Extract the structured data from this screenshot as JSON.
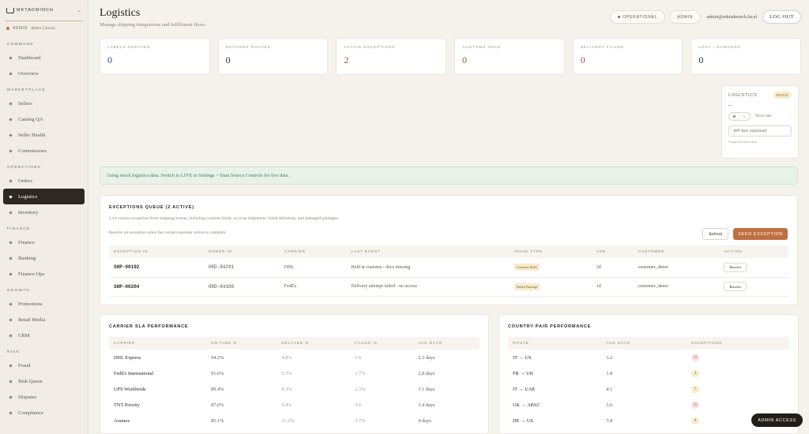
{
  "brand": {
    "name": "MKTADMINCH",
    "role_label": "ADMIN",
    "role_sub": "Admin Console"
  },
  "nav": {
    "sections": [
      {
        "title": "COMMAND",
        "items": [
          "Dashboard",
          "Overview"
        ]
      },
      {
        "title": "MARKETPLACE",
        "items": [
          "Sellers",
          "Catalog QA",
          "Seller Health",
          "Commissions"
        ]
      },
      {
        "title": "OPERATIONS",
        "items": [
          "Orders",
          "Logistics",
          "Inventory"
        ]
      },
      {
        "title": "FINANCE",
        "items": [
          "Finance",
          "Banking",
          "Finance Ops"
        ]
      },
      {
        "title": "GROWTH",
        "items": [
          "Promotions",
          "Retail Media",
          "CRM"
        ]
      },
      {
        "title": "RISK",
        "items": [
          "Fraud",
          "Risk Queue",
          "Disputes",
          "Compliance"
        ]
      }
    ],
    "active": "Logistics"
  },
  "header": {
    "title": "Logistics",
    "subtitle": "Manage shipping integrations and fulfillment flows",
    "status_pill": "OPERATIONAL",
    "admin_pill": "ADMIN",
    "email": "admin@mktadminch.local",
    "logout": "LOG OUT"
  },
  "kpis": [
    {
      "label": "LABELS CREATED",
      "value": "0",
      "color": "#3a4a8a"
    },
    {
      "label": "RETURNS ROUTED",
      "value": "0",
      "color": "#2a2520"
    },
    {
      "label": "ACTIVE EXCEPTIONS",
      "value": "2",
      "color": "#b54a4a"
    },
    {
      "label": "CUSTOMS HOLD",
      "value": "0",
      "color": "#8c6d1c"
    },
    {
      "label": "DELIVERY FAILED",
      "value": "0",
      "color": "#b54a4a"
    },
    {
      "label": "LOST / DAMAGED",
      "value": "0",
      "color": "#2a2520"
    }
  ],
  "data_source": {
    "title": "LOGISTICS",
    "badge": "MOCK",
    "toggle_m": "M",
    "toggle_l": "L",
    "toggle_label": "Mock data",
    "api_key_placeholder": "API Key (optional)",
    "hint": "Using local mock data"
  },
  "notice": "Using mock logistics data. Switch to LIVE in Settings > Data Source Controls for live data.",
  "exceptions": {
    "title": "EXCEPTIONS QUEUE (2 ACTIVE)",
    "desc": "Live carrier exceptions from shipping events, including customs holds, no-scan shipments, failed deliveries, and damaged packages.",
    "desc2": "Resolve an exception when the carrier/customer action is complete.",
    "refresh": "Refresh",
    "seed": "SEED EXCEPTION",
    "columns": [
      "EXCEPTION ID",
      "ORDER ID",
      "CARRIER",
      "LAST EVENT",
      "ISSUE TYPE",
      "AGE",
      "CUSTOMER",
      "ACTION"
    ],
    "rows": [
      {
        "id": "SHP-00192",
        "order": "ORD-84291",
        "carrier": "DHL",
        "event": "Held at customs - docs missing",
        "issue": "Customs Hold",
        "age": "3d",
        "customer": "customer_demo",
        "action": "Resolve"
      },
      {
        "id": "SHP-00204",
        "order": "ORD-84388",
        "carrier": "FedEx",
        "event": "Delivery attempt failed - no access",
        "issue": "Failed Attempt",
        "age": "1d",
        "customer": "customer_demo",
        "action": "Resolve"
      }
    ]
  },
  "sla": {
    "title": "CARRIER SLA PERFORMANCE",
    "columns": [
      "CARRIER",
      "ON-TIME %",
      "DELAYED %",
      "FAILED %",
      "AVG DAYS"
    ],
    "rows": [
      [
        "DHL Express",
        "94.2%",
        "4.8%",
        "1%",
        "2.3 days"
      ],
      [
        "FedEx International",
        "91.6%",
        "6.5%",
        "1.7%",
        "2.8 days"
      ],
      [
        "UPS Worldwide",
        "89.4%",
        "8.3%",
        "2.3%",
        "3.1 days"
      ],
      [
        "TNT Priority",
        "87.6%",
        "9.4%",
        "3%",
        "3.4 days"
      ],
      [
        "Aramex",
        "85.1%",
        "11.2%",
        "3.7%",
        "4 days"
      ]
    ]
  },
  "country_pairs": {
    "title": "COUNTRY-PAIR PERFORMANCE",
    "columns": [
      "ROUTE",
      "AVG DAYS",
      "EXCEPTIONS"
    ],
    "rows": [
      {
        "route": "IT → US",
        "days": "3.2",
        "exceptions": "12",
        "tone": "red"
      },
      {
        "route": "FR → UK",
        "days": "1.8",
        "exceptions": "4",
        "tone": "amber"
      },
      {
        "route": "IT → UAE",
        "days": "4.1",
        "exceptions": "7",
        "tone": "amber"
      },
      {
        "route": "UK → APAC",
        "days": "5.6",
        "exceptions": "15",
        "tone": "red"
      },
      {
        "route": "DE → US",
        "days": "3.8",
        "exceptions": "9",
        "tone": "amber"
      }
    ]
  },
  "admin_access": "ADMIN ACCESS"
}
